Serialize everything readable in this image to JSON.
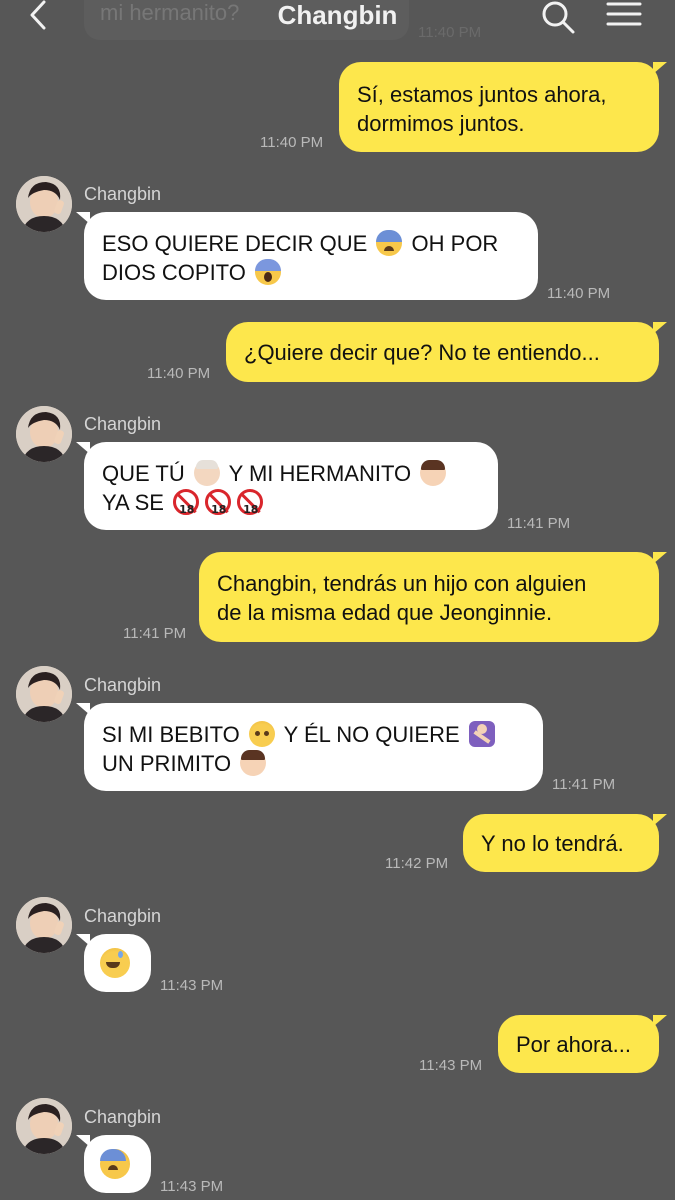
{
  "header": {
    "title": "Changbin",
    "back_icon": "chevron-left-icon",
    "search_icon": "search-icon",
    "menu_icon": "menu-icon",
    "previous_message_preview": "mi hermanito?",
    "previous_message_time": "11:40 PM"
  },
  "chat": {
    "contact_name": "Changbin",
    "colors": {
      "background": "#575757",
      "outgoing": "#fde74c",
      "incoming": "#ffffff"
    },
    "messages": [
      {
        "direction": "out",
        "lines": [
          "Sí, estamos juntos ahora,",
          "dormimos juntos."
        ],
        "time": "11:40 PM"
      },
      {
        "direction": "in",
        "sender": "Changbin",
        "lines": [
          "ESO QUIERE DECIR QUE",
          "OH POR",
          "DIOS COPITO"
        ],
        "emoji": [
          "anxious-face",
          "screaming-face"
        ],
        "time": "11:40 PM"
      },
      {
        "direction": "out",
        "lines": [
          "¿Quiere decir que? No te entiendo..."
        ],
        "time": "11:40 PM"
      },
      {
        "direction": "in",
        "sender": "Changbin",
        "lines": [
          "QUE TÚ",
          "Y MI HERMANITO",
          "YA SE"
        ],
        "emoji": [
          "old-man",
          "boy",
          "no-under-18",
          "no-under-18",
          "no-under-18"
        ],
        "time": "11:41 PM"
      },
      {
        "direction": "out",
        "lines": [
          "Changbin, tendrás un hijo con alguien",
          "de la misma edad que Jeonginnie."
        ],
        "time": "11:41 PM"
      },
      {
        "direction": "in",
        "sender": "Changbin",
        "lines": [
          "SI MI BEBITO",
          "Y ÉL NO QUIERE",
          "UN PRIMITO"
        ],
        "emoji": [
          "holding-back-tears",
          "person-gesturing-no",
          "boy"
        ],
        "time": "11:41 PM"
      },
      {
        "direction": "out",
        "lines": [
          "Y no lo tendrá."
        ],
        "time": "11:42 PM"
      },
      {
        "direction": "in",
        "sender": "Changbin",
        "emoji": [
          "grinning-sweat"
        ],
        "time": "11:43 PM"
      },
      {
        "direction": "out",
        "lines": [
          "Por ahora..."
        ],
        "time": "11:43 PM"
      },
      {
        "direction": "in",
        "sender": "Changbin",
        "emoji": [
          "anxious-face"
        ],
        "time": "11:43 PM"
      }
    ]
  }
}
